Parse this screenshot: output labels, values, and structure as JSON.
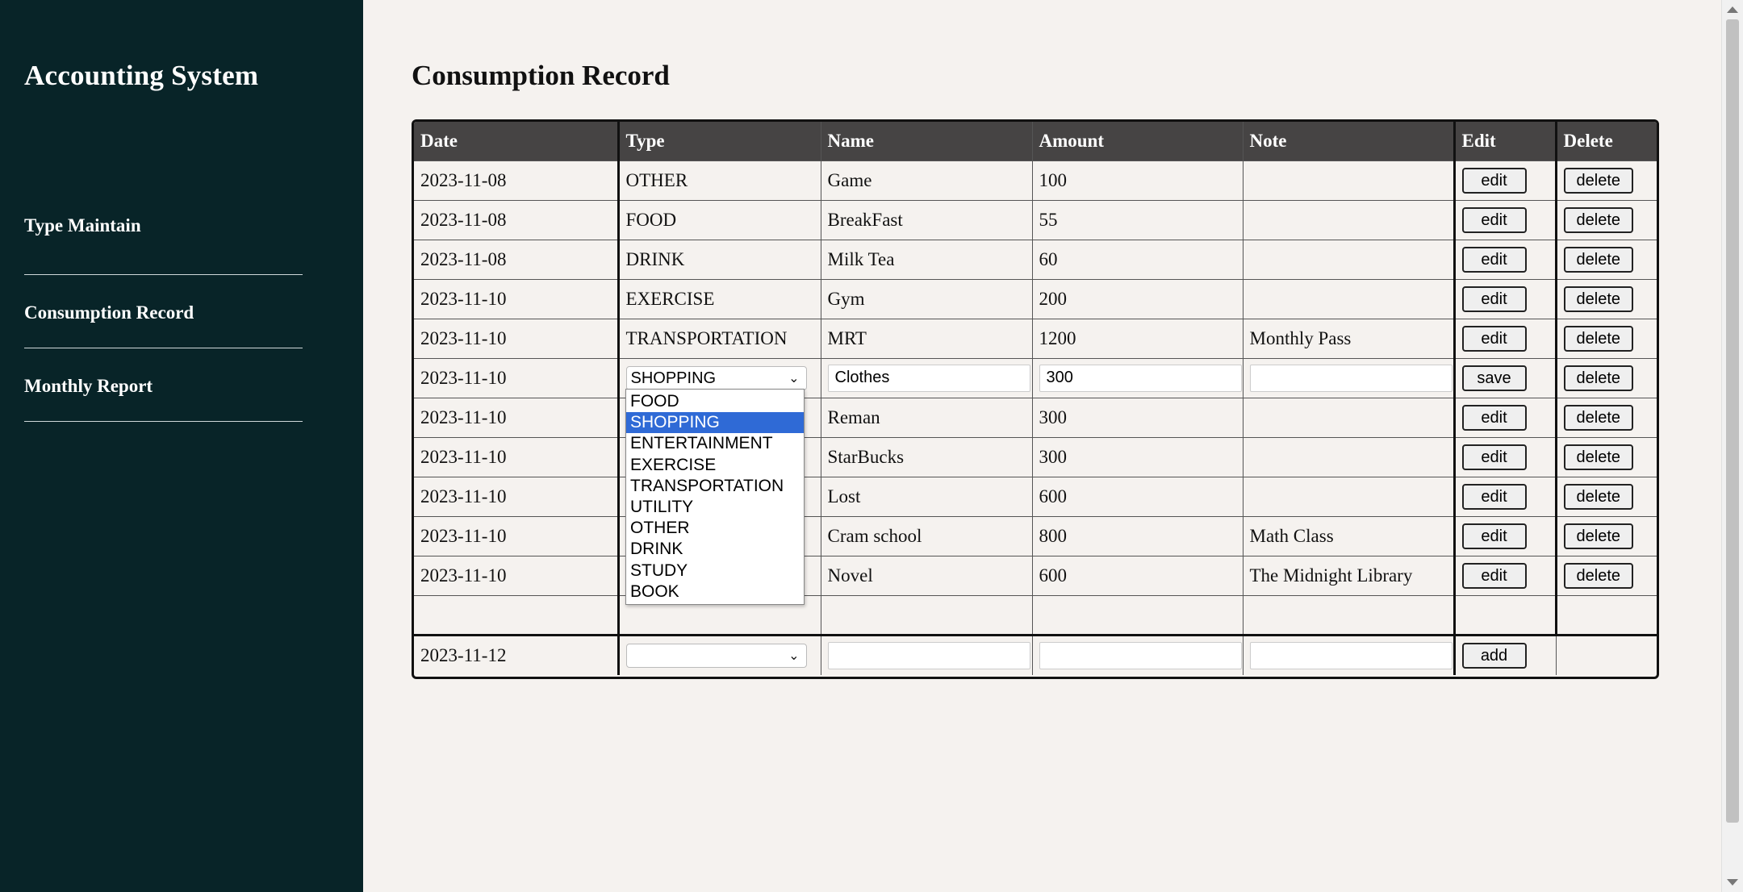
{
  "sidebar": {
    "title": "Accounting System",
    "items": [
      {
        "label": "Type Maintain"
      },
      {
        "label": "Consumption Record"
      },
      {
        "label": "Monthly Report"
      }
    ]
  },
  "main": {
    "title": "Consumption Record",
    "columns": [
      "Date",
      "Type",
      "Name",
      "Amount",
      "Note",
      "Edit",
      "Delete"
    ],
    "rows": [
      {
        "date": "2023-11-08",
        "type": "OTHER",
        "name": "Game",
        "amount": "100",
        "note": ""
      },
      {
        "date": "2023-11-08",
        "type": "FOOD",
        "name": "BreakFast",
        "amount": "55",
        "note": ""
      },
      {
        "date": "2023-11-08",
        "type": "DRINK",
        "name": "Milk Tea",
        "amount": "60",
        "note": ""
      },
      {
        "date": "2023-11-10",
        "type": "EXERCISE",
        "name": "Gym",
        "amount": "200",
        "note": ""
      },
      {
        "date": "2023-11-10",
        "type": "TRANSPORTATION",
        "name": "MRT",
        "amount": "1200",
        "note": "Monthly Pass"
      },
      {
        "date": "2023-11-10",
        "type": "SHOPPING",
        "name": "Clothes",
        "amount": "300",
        "note": "",
        "editing": true
      },
      {
        "date": "2023-11-10",
        "type": "",
        "name": "Reman",
        "amount": "300",
        "note": ""
      },
      {
        "date": "2023-11-10",
        "type": "",
        "name": "StarBucks",
        "amount": "300",
        "note": ""
      },
      {
        "date": "2023-11-10",
        "type": "",
        "name": "Lost",
        "amount": "600",
        "note": ""
      },
      {
        "date": "2023-11-10",
        "type": "",
        "name": "Cram school",
        "amount": "800",
        "note": "Math Class"
      },
      {
        "date": "2023-11-10",
        "type": "",
        "name": "Novel",
        "amount": "600",
        "note": "The Midnight Library"
      }
    ],
    "buttons": {
      "edit": "edit",
      "delete": "delete",
      "save": "save",
      "add": "add"
    },
    "new_row": {
      "date": "2023-11-12",
      "type": "",
      "name": "",
      "amount": "",
      "note": ""
    },
    "type_dropdown": {
      "selected": "SHOPPING",
      "options": [
        "FOOD",
        "SHOPPING",
        "ENTERTAINMENT",
        "EXERCISE",
        "TRANSPORTATION",
        "UTILITY",
        "OTHER",
        "DRINK",
        "STUDY",
        "BOOK"
      ]
    }
  },
  "colors": {
    "sidebar_bg": "#082428",
    "header_bg": "#464444",
    "page_bg": "#f5f2ef",
    "selected_option": "#2f6ad6"
  }
}
